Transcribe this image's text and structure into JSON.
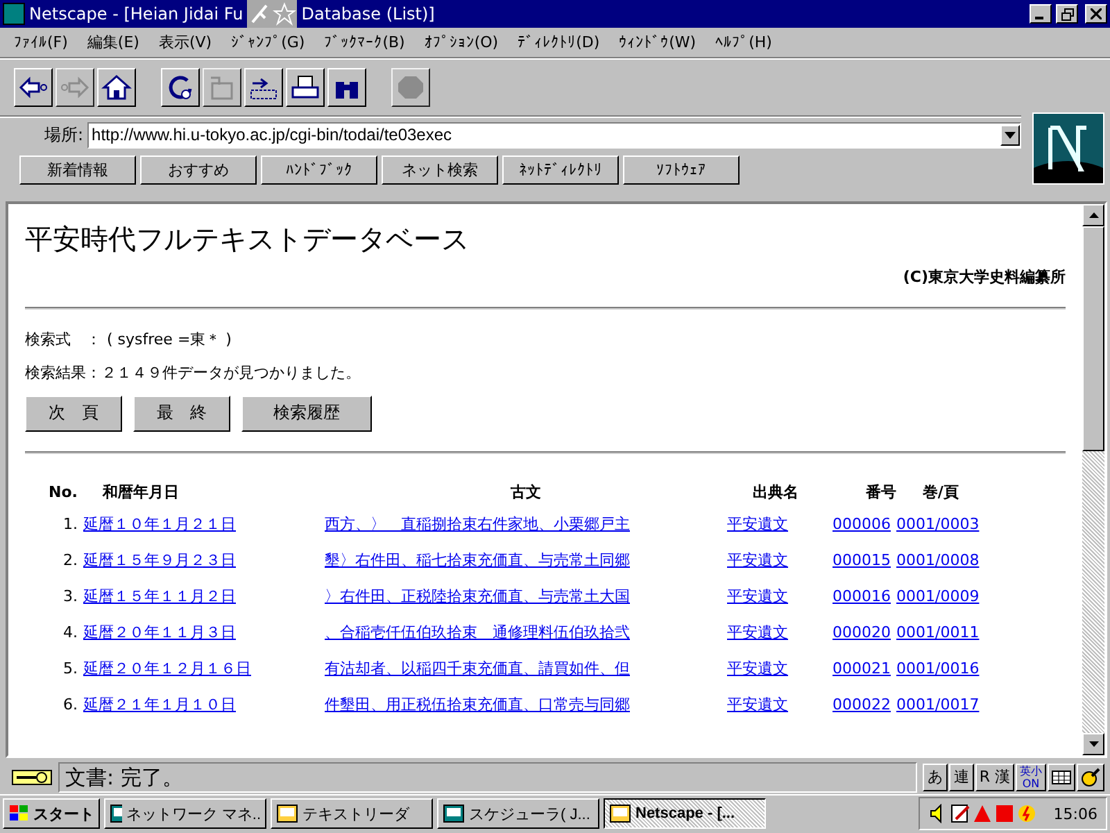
{
  "window": {
    "title_start": "Netscape - [Heian Jidai Fu",
    "title_end": "Database (List)]"
  },
  "menu": [
    "ﾌｧｲﾙ(F)",
    "編集(E)",
    "表示(V)",
    "ｼﾞｬﾝﾌﾟ(G)",
    "ﾌﾞｯｸﾏｰｸ(B)",
    "ｵﾌﾟｼｮﾝ(O)",
    "ﾃﾞｨﾚｸﾄﾘ(D)",
    "ｳｨﾝﾄﾞｳ(W)",
    "ﾍﾙﾌﾟ(H)"
  ],
  "toolbar": [
    {
      "kind": "back",
      "disabled": false
    },
    {
      "kind": "forward",
      "disabled": true
    },
    {
      "kind": "home",
      "disabled": false
    },
    {
      "kind": "reload",
      "disabled": false
    },
    {
      "kind": "images",
      "disabled": true
    },
    {
      "kind": "open",
      "disabled": false
    },
    {
      "kind": "print",
      "disabled": false
    },
    {
      "kind": "find",
      "disabled": false
    },
    {
      "kind": "stop",
      "disabled": true
    }
  ],
  "location": {
    "label": "場所:",
    "value": "http://www.hi.u-tokyo.ac.jp/cgi-bin/todai/te03exec"
  },
  "directory_buttons": [
    "新着情報",
    "おすすめ",
    "ﾊﾝﾄﾞﾌﾞｯｸ",
    "ネット検索",
    "ﾈｯﾄﾃﾞｨﾚｸﾄﾘ",
    "ｿﾌﾄｳｪｱ"
  ],
  "page": {
    "title": "平安時代フルテキストデータベース",
    "credit": "(C)東京大学史料編纂所",
    "query_label": "検索式　：",
    "query": "( sysfree =東＊ )",
    "result": "検索結果：２１４９件データが見つかりました。",
    "buttons": [
      "次　頁",
      "最　終",
      "検索履歴"
    ],
    "columns": [
      "No.",
      "和暦年月日",
      "古文",
      "出典名",
      "番号",
      "巻/頁"
    ],
    "rows": [
      {
        "no": "1.",
        "date": "延暦１０年１月２１日",
        "text": "西方、〉　直稲捌拾束右件家地、小栗郷戸主",
        "source": "平安遺文",
        "number": "000006",
        "page": "0001/0003"
      },
      {
        "no": "2.",
        "date": "延暦１５年９月２３日",
        "text": "墾〉右件田、稲七拾束充価直、与売常土同郷",
        "source": "平安遺文",
        "number": "000015",
        "page": "0001/0008"
      },
      {
        "no": "3.",
        "date": "延暦１５年１１月２日",
        "text": "〉右件田、正税陸拾束充価直、与売常土大国",
        "source": "平安遺文",
        "number": "000016",
        "page": "0001/0009"
      },
      {
        "no": "4.",
        "date": "延暦２０年１１月３日",
        "text": "、合稲壱仟伍伯玖拾束　通修理料伍伯玖拾弐",
        "source": "平安遺文",
        "number": "000020",
        "page": "0001/0011"
      },
      {
        "no": "5.",
        "date": "延暦２０年１２月１６日",
        "text": "有沽却者、以稲四千束充価直、請買如件、但",
        "source": "平安遺文",
        "number": "000021",
        "page": "0001/0016"
      },
      {
        "no": "6.",
        "date": "延暦２１年１月１０日",
        "text": "件墾田、用正税伍拾束充価直、口常売与同郷",
        "source": "平安遺文",
        "number": "000022",
        "page": "0001/0017"
      }
    ]
  },
  "status_bar": {
    "text": "文書: 完了。",
    "ime": [
      "あ",
      "連",
      "R 漢",
      "英小ON"
    ]
  },
  "taskbar": {
    "start": "スタート",
    "tasks": [
      {
        "label": "ネットワーク マネ..",
        "selected": false
      },
      {
        "label": "テキストリーダ",
        "selected": false
      },
      {
        "label": "スケジューラ( J...",
        "selected": false
      },
      {
        "label": "Netscape - [...",
        "selected": true
      }
    ],
    "clock": "15:06"
  }
}
